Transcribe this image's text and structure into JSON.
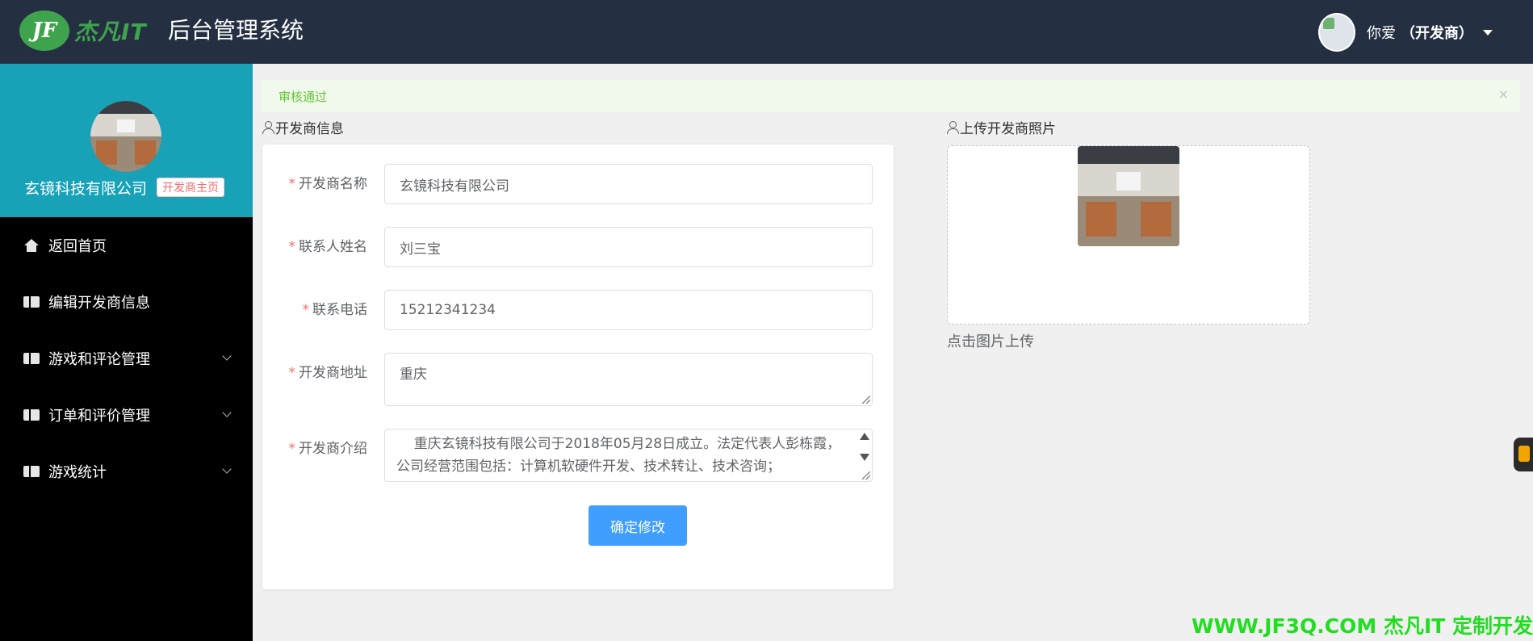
{
  "header": {
    "logo_text": "杰凡IT",
    "logo_mark": "JF",
    "system_title": "后台管理系统",
    "user_name": "你爱",
    "user_role": "（开发商）"
  },
  "sidebar": {
    "profile_name": "玄镜科技有限公司",
    "profile_badge": "开发商主页",
    "items": [
      {
        "label": "返回首页",
        "icon": "home-icon",
        "expandable": false
      },
      {
        "label": "编辑开发商信息",
        "icon": "ticket-icon",
        "expandable": false
      },
      {
        "label": "游戏和评论管理",
        "icon": "ticket-icon",
        "expandable": true
      },
      {
        "label": "订单和评价管理",
        "icon": "ticket-icon",
        "expandable": true
      },
      {
        "label": "游戏统计",
        "icon": "ticket-icon",
        "expandable": true
      }
    ]
  },
  "alert": {
    "text": "审核通过",
    "close": "×"
  },
  "form": {
    "section_title": "开发商信息",
    "fields": {
      "name": {
        "label": "开发商名称",
        "value": "玄镜科技有限公司"
      },
      "contact": {
        "label": "联系人姓名",
        "value": "刘三宝"
      },
      "phone": {
        "label": "联系电话",
        "value": "15212341234"
      },
      "address": {
        "label": "开发商地址",
        "value": "重庆"
      },
      "intro": {
        "label": "开发商介绍",
        "value": "    重庆玄镜科技有限公司于2018年05月28日成立。法定代表人彭栋霞，公司经营范围包括：计算机软硬件开发、技术转让、技术咨询；"
      }
    },
    "required_mark": "*",
    "submit_label": "确定修改"
  },
  "upload": {
    "section_title": "上传开发商照片",
    "hint": "点击图片上传"
  },
  "watermark": "WWW.JF3Q.COM 杰凡IT  定制开发",
  "colors": {
    "header_bg": "#242f42",
    "sidebar_bg": "#000000",
    "profile_bg": "#17a2b8",
    "primary": "#409eff",
    "success": "#67c23a",
    "danger": "#f56c6c",
    "brand_green": "#3fa34d"
  }
}
